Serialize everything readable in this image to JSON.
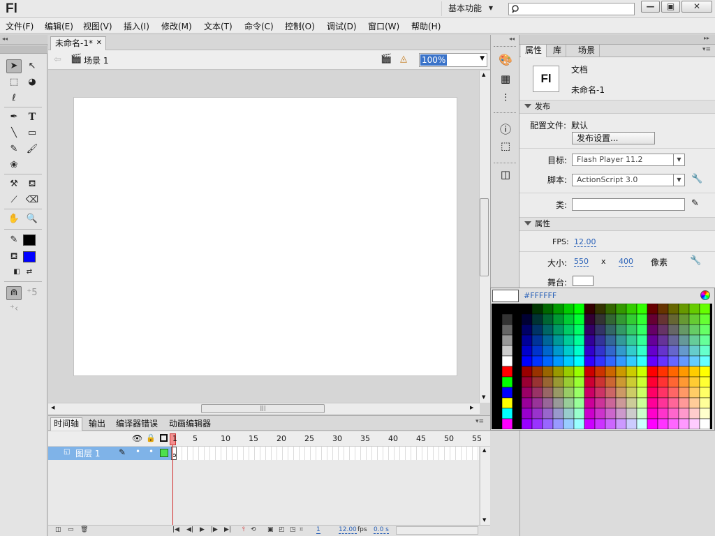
{
  "app": {
    "logo": "Fl",
    "workspace": "基本功能"
  },
  "menu": [
    "文件(F)",
    "编辑(E)",
    "视图(V)",
    "插入(I)",
    "修改(M)",
    "文本(T)",
    "命令(C)",
    "控制(O)",
    "调试(D)",
    "窗口(W)",
    "帮助(H)"
  ],
  "document": {
    "tab_label": "未命名-1*",
    "scene_label": "场景 1",
    "zoom": "100%"
  },
  "timeline": {
    "tabs": [
      "时间轴",
      "输出",
      "编译器错误",
      "动画编辑器"
    ],
    "frame_numbers": [
      "1",
      "5",
      "10",
      "15",
      "20",
      "25",
      "30",
      "35",
      "40",
      "45",
      "50",
      "55"
    ],
    "layer_name": "图层 1",
    "footer": {
      "current_frame": "1",
      "fps": "12.00",
      "fps_unit": "fps",
      "time": "0.0 s"
    }
  },
  "properties": {
    "tabs": [
      "属性",
      "库",
      "场景"
    ],
    "doc_type": "文档",
    "doc_name": "未命名-1",
    "publish": {
      "section": "发布",
      "profile_label": "配置文件:",
      "profile_value": "默认",
      "settings_button": "发布设置...",
      "target_label": "目标:",
      "target_value": "Flash Player 11.2",
      "script_label": "脚本:",
      "script_value": "ActionScript 3.0",
      "class_label": "类:"
    },
    "props": {
      "section": "属性",
      "fps_label": "FPS:",
      "fps_value": "12.00",
      "size_label": "大小:",
      "width": "550",
      "x_sep": "x",
      "height": "400",
      "unit": "像素",
      "stage_label": "舞台:"
    }
  },
  "color_picker": {
    "hex": "#FFFFFF",
    "stage_color": "#FFFFFF"
  },
  "colors": {
    "stroke": "#000000",
    "fill": "#0000FF",
    "layer_highlight": "#7FB3E8",
    "playhead": "#D12A2A"
  }
}
